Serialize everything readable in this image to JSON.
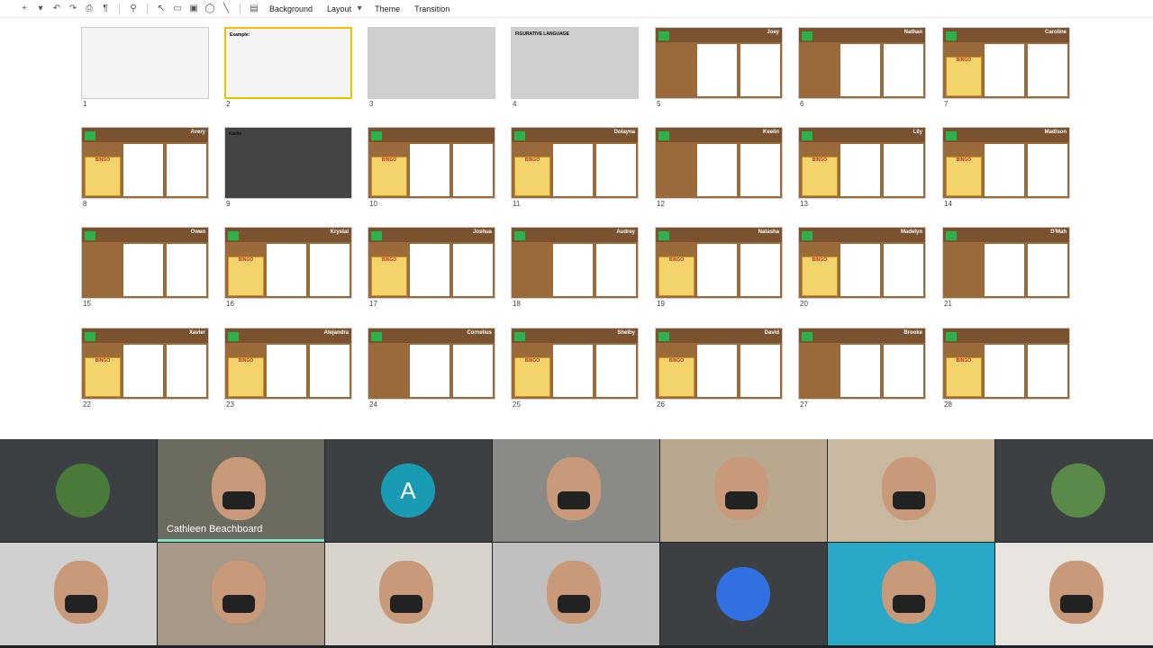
{
  "toolbar": {
    "icons": [
      "add-icon",
      "undo-icon",
      "redo-icon",
      "print-icon",
      "paint-format-icon",
      "zoom-icon",
      "select-icon",
      "textbox-icon",
      "image-icon",
      "shape-icon",
      "line-icon",
      "comment-icon"
    ],
    "background_label": "Background",
    "layout_label": "Layout",
    "theme_label": "Theme",
    "transition_label": "Transition"
  },
  "slides": [
    {
      "num": "1",
      "style": "white",
      "name": ""
    },
    {
      "num": "2",
      "style": "white",
      "name": "Example:",
      "selected": true
    },
    {
      "num": "3",
      "style": "grey",
      "name": ""
    },
    {
      "num": "4",
      "style": "grey",
      "name": "FIGURATIVE LANGUAGE"
    },
    {
      "num": "5",
      "style": "wood",
      "name": "Joey"
    },
    {
      "num": "6",
      "style": "wood",
      "name": "Nathan"
    },
    {
      "num": "7",
      "style": "wood",
      "name": "Caroline"
    },
    {
      "num": "8",
      "style": "wood",
      "name": "Avery"
    },
    {
      "num": "9",
      "style": "dark",
      "name": "Kaider"
    },
    {
      "num": "10",
      "style": "wood",
      "name": ""
    },
    {
      "num": "11",
      "style": "wood",
      "name": "Dolayna"
    },
    {
      "num": "12",
      "style": "wood",
      "name": "Keelin"
    },
    {
      "num": "13",
      "style": "wood",
      "name": "Lily"
    },
    {
      "num": "14",
      "style": "wood",
      "name": "Madison"
    },
    {
      "num": "15",
      "style": "wood",
      "name": "Owen"
    },
    {
      "num": "16",
      "style": "wood",
      "name": "Krystal"
    },
    {
      "num": "17",
      "style": "wood",
      "name": "Joshua"
    },
    {
      "num": "18",
      "style": "wood",
      "name": "Audrey"
    },
    {
      "num": "19",
      "style": "wood",
      "name": "Natasha"
    },
    {
      "num": "20",
      "style": "wood",
      "name": "Madelyn"
    },
    {
      "num": "21",
      "style": "wood",
      "name": "D'Mah"
    },
    {
      "num": "22",
      "style": "wood",
      "name": "Xavier"
    },
    {
      "num": "23",
      "style": "wood",
      "name": "Alejandra"
    },
    {
      "num": "24",
      "style": "wood",
      "name": "Cornelius"
    },
    {
      "num": "25",
      "style": "wood",
      "name": "Shelby"
    },
    {
      "num": "26",
      "style": "wood",
      "name": "David"
    },
    {
      "num": "27",
      "style": "wood",
      "name": "Brooke"
    },
    {
      "num": "28",
      "style": "wood",
      "name": ""
    }
  ],
  "bingo_label": "BINGO",
  "participants": [
    {
      "kind": "photo-avatar",
      "name": "",
      "color": "#4a7a3a"
    },
    {
      "kind": "video",
      "name": "Cathleen Beachboard",
      "active": true,
      "bg": "#6b6b60"
    },
    {
      "kind": "letter",
      "name": "",
      "letter": "A"
    },
    {
      "kind": "video",
      "name": "",
      "bg": "#8a8a86"
    },
    {
      "kind": "video",
      "name": "",
      "bg": "#b8a890"
    },
    {
      "kind": "video",
      "name": "",
      "bg": "#c8b8a0"
    },
    {
      "kind": "photo-avatar",
      "name": "",
      "color": "#5a8a4a"
    },
    {
      "kind": "video",
      "name": "",
      "bg": "#d0d0d0"
    },
    {
      "kind": "video",
      "name": "",
      "bg": "#a89888"
    },
    {
      "kind": "video",
      "name": "",
      "bg": "#d8d4cc"
    },
    {
      "kind": "video",
      "name": "",
      "bg": "#c0c0c0"
    },
    {
      "kind": "emblem",
      "name": "",
      "color": "#3070e0"
    },
    {
      "kind": "video",
      "name": "",
      "bg": "#2aa8c8"
    },
    {
      "kind": "video",
      "name": "",
      "bg": "#e8e4e0"
    }
  ]
}
